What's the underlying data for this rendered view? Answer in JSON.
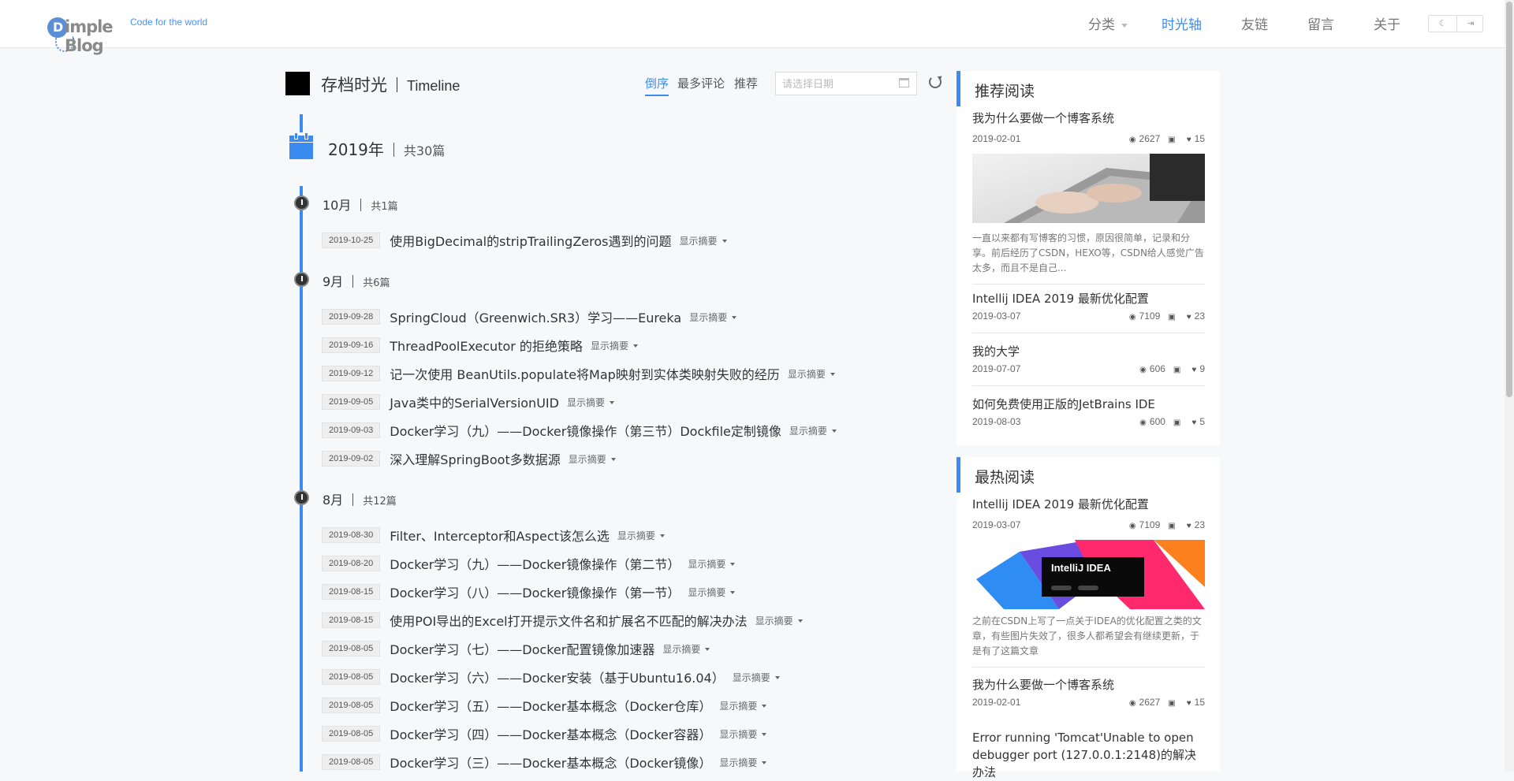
{
  "header": {
    "logo_text": "Dimple Blog",
    "slogan": "Code for the world",
    "nav": [
      {
        "label": "分类",
        "dropdown": true
      },
      {
        "label": "时光轴",
        "active": true
      },
      {
        "label": "友链"
      },
      {
        "label": "留言"
      },
      {
        "label": "关于"
      }
    ]
  },
  "page": {
    "title": "存档时光",
    "title_en": "Timeline",
    "sort_options": [
      "倒序",
      "最多评论",
      "推荐"
    ],
    "active_sort": "倒序",
    "date_placeholder": "请选择日期"
  },
  "timeline": {
    "year": "2019年",
    "year_count": "共30篇",
    "more_label": "显示摘要",
    "months": [
      {
        "month": "10月",
        "count": "共1篇",
        "posts": [
          {
            "date": "2019-10-25",
            "title": "使用BigDecimal的stripTrailingZeros遇到的问题"
          }
        ]
      },
      {
        "month": "9月",
        "count": "共6篇",
        "posts": [
          {
            "date": "2019-09-28",
            "title": "SpringCloud（Greenwich.SR3）学习——Eureka"
          },
          {
            "date": "2019-09-16",
            "title": "ThreadPoolExecutor 的拒绝策略"
          },
          {
            "date": "2019-09-12",
            "title": "记一次使用 BeanUtils.populate将Map映射到实体类映射失败的经历"
          },
          {
            "date": "2019-09-05",
            "title": "Java类中的SerialVersionUID"
          },
          {
            "date": "2019-09-03",
            "title": "Docker学习（九）——Docker镜像操作（第三节）Dockfile定制镜像"
          },
          {
            "date": "2019-09-02",
            "title": "深入理解SpringBoot多数据源"
          }
        ]
      },
      {
        "month": "8月",
        "count": "共12篇",
        "posts": [
          {
            "date": "2019-08-30",
            "title": "Filter、Interceptor和Aspect该怎么选"
          },
          {
            "date": "2019-08-20",
            "title": "Docker学习（九）——Docker镜像操作（第二节）"
          },
          {
            "date": "2019-08-15",
            "title": "Docker学习（八）——Docker镜像操作（第一节）"
          },
          {
            "date": "2019-08-15",
            "title": "使用POI导出的Excel打开提示文件名和扩展名不匹配的解决办法"
          },
          {
            "date": "2019-08-05",
            "title": "Docker学习（七）——Docker配置镜像加速器"
          },
          {
            "date": "2019-08-05",
            "title": "Docker学习（六）——Docker安装（基于Ubuntu16.04）"
          },
          {
            "date": "2019-08-05",
            "title": "Docker学习（五）——Docker基本概念（Docker仓库）"
          },
          {
            "date": "2019-08-05",
            "title": "Docker学习（四）——Docker基本概念（Docker容器）"
          },
          {
            "date": "2019-08-05",
            "title": "Docker学习（三）——Docker基本概念（Docker镜像）"
          }
        ]
      }
    ]
  },
  "sidebar": {
    "recommended": {
      "title": "推荐阅读",
      "articles": [
        {
          "title": "我为什么要做一个博客系统",
          "date": "2019-02-01",
          "views": "2627",
          "likes": "15",
          "has_image": true,
          "image": "laptop-photo",
          "desc": "一直以来都有写博客的习惯，原因很简单，记录和分享。前后经历了CSDN，HEXO等，CSDN给人感觉广告太多，而且不是自己..."
        },
        {
          "title": "Intellij IDEA 2019 最新优化配置",
          "date": "2019-03-07",
          "views": "7109",
          "likes": "23"
        },
        {
          "title": "我的大学",
          "date": "2019-07-07",
          "views": "606",
          "likes": "9"
        },
        {
          "title": "如何免费使用正版的JetBrains IDE",
          "date": "2019-08-03",
          "views": "600",
          "likes": "5"
        }
      ]
    },
    "hottest": {
      "title": "最热阅读",
      "articles": [
        {
          "title": "Intellij IDEA 2019 最新优化配置",
          "date": "2019-03-07",
          "views": "7109",
          "likes": "23",
          "has_image": true,
          "image": "intellij-banner",
          "image_text": "IntelliJ IDEA",
          "desc": "之前在CSDN上写了一点关于IDEA的优化配置之类的文章，有些图片失效了，很多人都希望会有继续更新，于是有了这篇文章"
        },
        {
          "title": "我为什么要做一个博客系统",
          "date": "2019-02-01",
          "views": "2627",
          "likes": "15"
        },
        {
          "title": "Error running 'Tomcat'Unable to open debugger port (127.0.0.1:2148)的解决办法"
        }
      ]
    }
  },
  "colors": {
    "accent": "#3b8bf0",
    "background": "#f7f8fa"
  }
}
